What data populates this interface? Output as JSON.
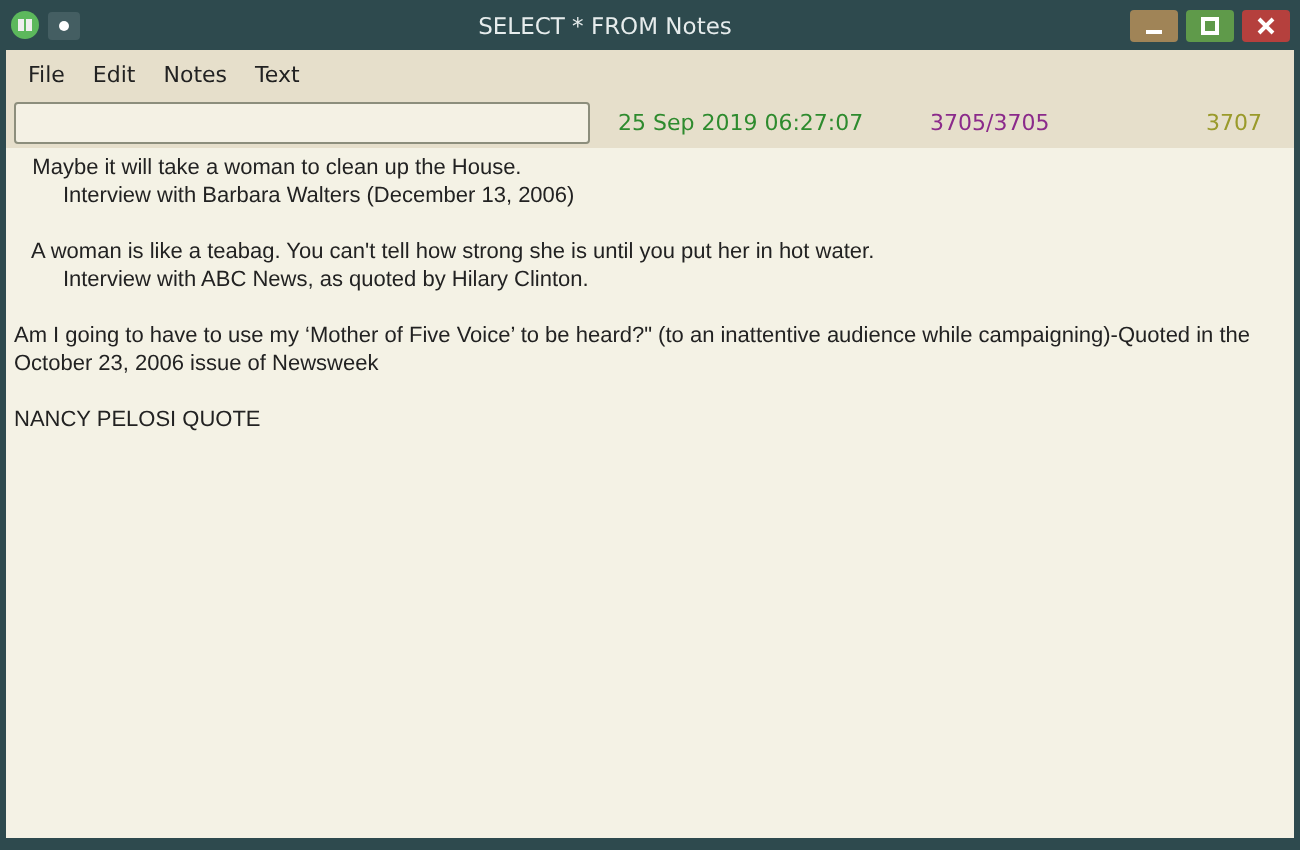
{
  "window": {
    "title": "SELECT * FROM Notes"
  },
  "menu": [
    "File",
    "Edit",
    "Notes",
    "Text"
  ],
  "toolbar": {
    "date": "25 Sep 2019",
    "time": "06:27:07",
    "position": "3705/3705",
    "total": "3707"
  },
  "note": [
    {
      "lines": [
        "   Maybe it will take a woman to clean up the House.",
        "        Interview with Barbara Walters (December 13, 2006)"
      ]
    },
    {
      "lines": [
        "   A woman is like a teabag. You can't tell how strong she is until you put her in hot water.",
        "        Interview with ABC News, as quoted by Hilary Clinton."
      ]
    },
    {
      "lines": [
        "Am I going to have to use my ‘Mother of Five Voice’ to be heard?\" (to an inattentive audience while campaigning)-Quoted in the",
        "October 23, 2006 issue of Newsweek"
      ]
    },
    {
      "lines": [
        "NANCY PELOSI QUOTE"
      ]
    }
  ]
}
